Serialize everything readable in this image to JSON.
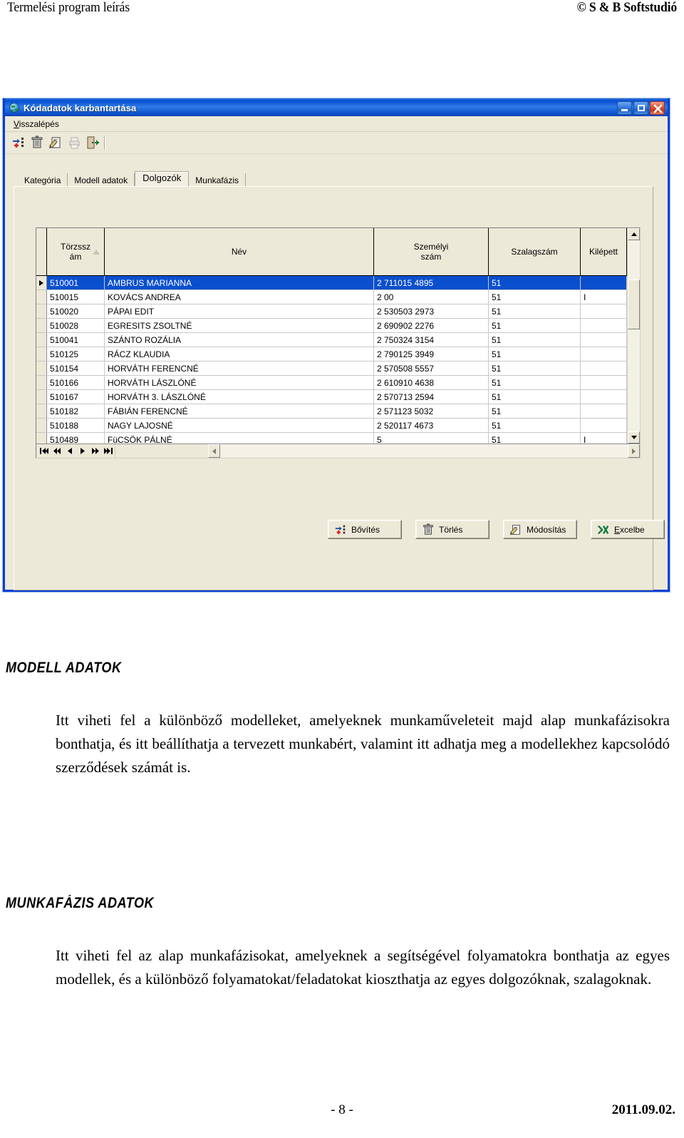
{
  "doc_header": {
    "left": "Termelési program leírás",
    "right": "© S & B Softstudió"
  },
  "window": {
    "title": "Kódadatok karbantartása",
    "title_icon": "globe-icon",
    "buttons": {
      "minimize": "minimize-icon",
      "maximize": "maximize-icon",
      "close": "close-icon"
    },
    "menu": [
      {
        "label": "Visszalépés",
        "accel": "V"
      }
    ],
    "toolbar": [
      {
        "name": "add-record-icon",
        "title": "Bővítés"
      },
      {
        "name": "delete-record-icon",
        "title": "Törlés"
      },
      {
        "name": "edit-record-icon",
        "title": "Módosítás"
      },
      {
        "name": "print-icon",
        "title": "Nyomtatás",
        "disabled": true
      },
      {
        "name": "exit-icon",
        "title": "Kilépés"
      }
    ],
    "tabs": [
      {
        "label": "Kategória",
        "active": false
      },
      {
        "label": "Modell adatok",
        "active": false
      },
      {
        "label": "Dolgozók",
        "active": true
      },
      {
        "label": "Munkafázis",
        "active": false
      }
    ]
  },
  "grid": {
    "columns": [
      {
        "key": "torzsszam",
        "label_lines": [
          "Törzssz",
          "ám"
        ],
        "sorted": true
      },
      {
        "key": "nev",
        "label_lines": [
          "Név"
        ],
        "sorted": false
      },
      {
        "key": "szemelyi",
        "label_lines": [
          "Személyi",
          "szám"
        ],
        "sorted": false
      },
      {
        "key": "szalagszam",
        "label_lines": [
          "Szalagszám"
        ],
        "sorted": false
      },
      {
        "key": "kilepett",
        "label_lines": [
          "Kilépett"
        ],
        "sorted": false
      }
    ],
    "rows": [
      {
        "torzsszam": "510001",
        "nev": "AMBRUS MARIANNA",
        "szemelyi": "2 711015 4895",
        "szalagszam": "51",
        "kilepett": "",
        "selected": true
      },
      {
        "torzsszam": "510015",
        "nev": "KOVÁCS ANDREA",
        "szemelyi": "2 00",
        "szalagszam": "51",
        "kilepett": "I",
        "selected": false
      },
      {
        "torzsszam": "510020",
        "nev": "PÁPAI EDIT",
        "szemelyi": "2 530503 2973",
        "szalagszam": "51",
        "kilepett": "",
        "selected": false
      },
      {
        "torzsszam": "510028",
        "nev": "EGRESITS ZSOLTNÉ",
        "szemelyi": "2 690902 2276",
        "szalagszam": "51",
        "kilepett": "",
        "selected": false
      },
      {
        "torzsszam": "510041",
        "nev": "SZÁNTO ROZÁLIA",
        "szemelyi": "2 750324 3154",
        "szalagszam": "51",
        "kilepett": "",
        "selected": false
      },
      {
        "torzsszam": "510125",
        "nev": "RÁCZ KLAUDIA",
        "szemelyi": "2 790125 3949",
        "szalagszam": "51",
        "kilepett": "",
        "selected": false
      },
      {
        "torzsszam": "510154",
        "nev": "HORVÁTH FERENCNÉ",
        "szemelyi": "2 570508 5557",
        "szalagszam": "51",
        "kilepett": "",
        "selected": false
      },
      {
        "torzsszam": "510166",
        "nev": "HORVÁTH LÁSZLÓNÉ",
        "szemelyi": "2 610910 4638",
        "szalagszam": "51",
        "kilepett": "",
        "selected": false
      },
      {
        "torzsszam": "510167",
        "nev": "HORVÁTH 3. LÁSZLÓNÉ",
        "szemelyi": "2 570713 2594",
        "szalagszam": "51",
        "kilepett": "",
        "selected": false
      },
      {
        "torzsszam": "510182",
        "nev": "FÁBIÁN FERENCNÉ",
        "szemelyi": "2 571123 5032",
        "szalagszam": "51",
        "kilepett": "",
        "selected": false
      },
      {
        "torzsszam": "510188",
        "nev": "NAGY LAJOSNÉ",
        "szemelyi": "2 520117 4673",
        "szalagszam": "51",
        "kilepett": "",
        "selected": false
      },
      {
        "torzsszam": "510489",
        "nev": "FüCSÖK PÁLNÉ",
        "szemelyi": "5",
        "szalagszam": "51",
        "kilepett": "I",
        "selected": false
      }
    ],
    "navigator": [
      {
        "name": "nav-first-button",
        "glyph": "first"
      },
      {
        "name": "nav-prev-page-button",
        "glyph": "prevpage"
      },
      {
        "name": "nav-prev-button",
        "glyph": "prev"
      },
      {
        "name": "nav-next-button",
        "glyph": "next"
      },
      {
        "name": "nav-next-page-button",
        "glyph": "nextpage"
      },
      {
        "name": "nav-last-button",
        "glyph": "last"
      }
    ]
  },
  "action_buttons": [
    {
      "name": "add-button",
      "label": "Bővítés",
      "icon": "add-record-icon"
    },
    {
      "name": "delete-button",
      "label": "Törlés",
      "icon": "delete-record-icon"
    },
    {
      "name": "modify-button",
      "label": "Módosítás",
      "icon": "edit-record-icon"
    },
    {
      "name": "excel-button",
      "label": "Excelbe",
      "icon": "excel-icon",
      "accel_prefix": "E",
      "accel_rest": "xcelbe"
    }
  ],
  "document": {
    "sections": [
      {
        "heading": "MODELL ADATOK",
        "paragraph": "Itt viheti fel a különböző modelleket, amelyeknek munkaműveleteit majd alap munkafázisokra bonthatja, és itt beállíthatja a tervezett munkabért, valamint itt adhatja meg a modellekhez kapcsolódó szerződések számát is."
      },
      {
        "heading": "MUNKAFÁZIS  ADATOK",
        "paragraph": "Itt viheti fel az alap munkafázisokat, amelyeknek a segítségével folyamatokra bonthatja az egyes modellek, és a különböző folyamatokat/feladatokat kioszthatja az egyes dolgozóknak, szalagoknak."
      }
    ]
  },
  "footer": {
    "page": "- 8 -",
    "date": "2011.09.02."
  },
  "colors": {
    "titlebar_blue": "#0b4fd0",
    "window_border": "#0a3fd4",
    "client_beige": "#ece9d8",
    "selection_blue": "#0a4fce"
  }
}
